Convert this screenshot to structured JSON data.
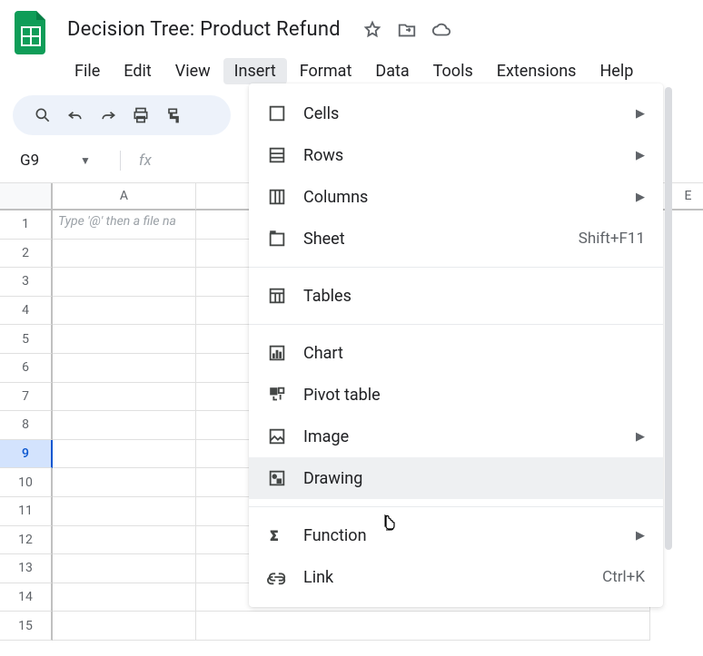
{
  "doc_title": "Decision Tree: Product Refund",
  "menus": [
    "File",
    "Edit",
    "View",
    "Insert",
    "Format",
    "Data",
    "Tools",
    "Extensions",
    "Help"
  ],
  "active_menu_index": 3,
  "cell_reference": "G9",
  "placeholder_text": "Type '@' then a file na",
  "column_headers": {
    "a": "A",
    "e": "E"
  },
  "row_numbers": [
    1,
    2,
    3,
    4,
    5,
    6,
    7,
    8,
    9,
    10,
    11,
    12,
    13,
    14,
    15
  ],
  "selected_row": 9,
  "insert_menu": {
    "cells": "Cells",
    "rows": "Rows",
    "columns": "Columns",
    "sheet": "Sheet",
    "sheet_shortcut": "Shift+F11",
    "tables": "Tables",
    "chart": "Chart",
    "pivot": "Pivot table",
    "image": "Image",
    "drawing": "Drawing",
    "function": "Function",
    "link": "Link",
    "link_shortcut": "Ctrl+K"
  }
}
